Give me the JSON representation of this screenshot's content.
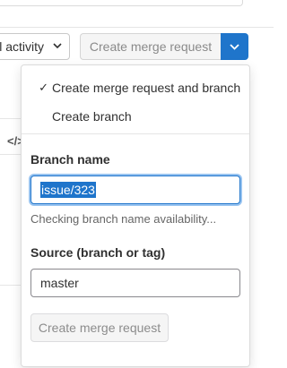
{
  "background": {
    "activity_filter_label": "ll activity",
    "code_icon_text": "</>",
    "merge_request_button_label": "Create merge request"
  },
  "dropdown": {
    "options": [
      {
        "label": "Create merge request and branch",
        "selected": true,
        "check": "✓"
      },
      {
        "label": "Create branch",
        "selected": false,
        "check": ""
      }
    ],
    "branch_name": {
      "label": "Branch name",
      "value": "issue/323",
      "hint": "Checking branch name availability..."
    },
    "source": {
      "label": "Source (branch or tag)",
      "value": "master"
    },
    "submit_label": "Create merge request"
  },
  "colors": {
    "accent": "#1f75cb",
    "focus_ring": "#97c3f0"
  }
}
